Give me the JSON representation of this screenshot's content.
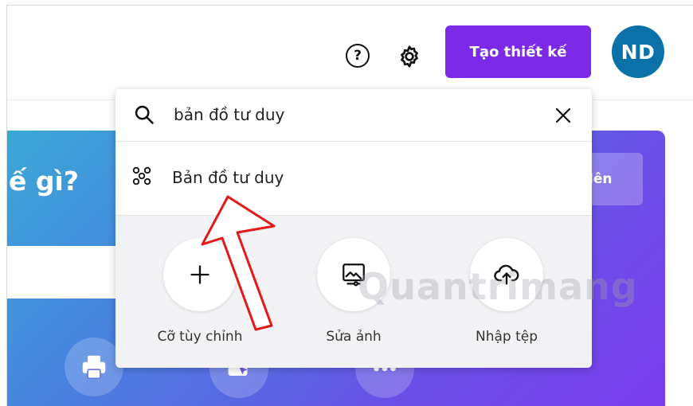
{
  "header": {
    "help_icon": "help-circle-icon",
    "settings_icon": "gear-icon",
    "create_button_label": "Tạo thiết kế",
    "avatar_initials": "ND",
    "colors": {
      "accent": "#7d2ae8",
      "avatar": "#0a72a8"
    }
  },
  "hero": {
    "title": "ế gì?",
    "upload_button_label": "lên",
    "categories": [
      {
        "icon": "printer-icon"
      },
      {
        "icon": "cursor-click-icon"
      },
      {
        "icon": "more-dots-icon"
      }
    ]
  },
  "dropdown": {
    "search_value": "bản đồ tư duy",
    "search_icon": "search-icon",
    "clear_icon": "close-icon",
    "result": {
      "label": "Bản đồ tư duy",
      "icon": "mind-map-icon"
    },
    "quick_actions": [
      {
        "label": "Cỡ tùy chỉnh",
        "icon": "plus-icon"
      },
      {
        "label": "Sửa ảnh",
        "icon": "edit-photo-icon"
      },
      {
        "label": "Nhập tệp",
        "icon": "cloud-upload-icon"
      }
    ]
  },
  "watermark": "Quantrimang"
}
